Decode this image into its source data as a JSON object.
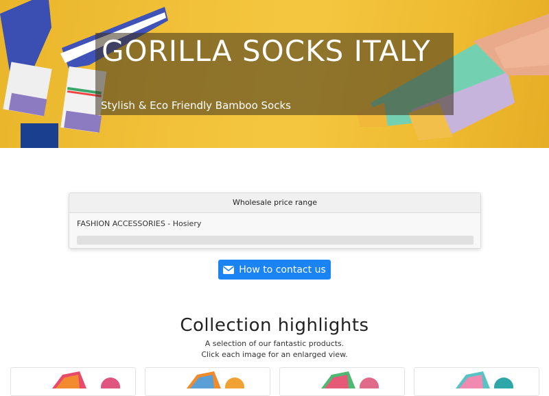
{
  "hero": {
    "title": "GORILLA SOCKS ITALY",
    "subtitle": "Stylish & Eco Friendly Bamboo Socks"
  },
  "price_card": {
    "header": "Wholesale price range",
    "category": "FASHION ACCESSORIES - Hosiery"
  },
  "contact": {
    "label": "How to contact us",
    "icon": "envelope-icon"
  },
  "collection": {
    "title": "Collection highlights",
    "subtitle_line1": "A selection of our fantastic products.",
    "subtitle_line2": "Click each image for an enlarged view."
  },
  "colors": {
    "hero_yellow": "#f2c23a",
    "button_blue": "#1a84f5"
  }
}
